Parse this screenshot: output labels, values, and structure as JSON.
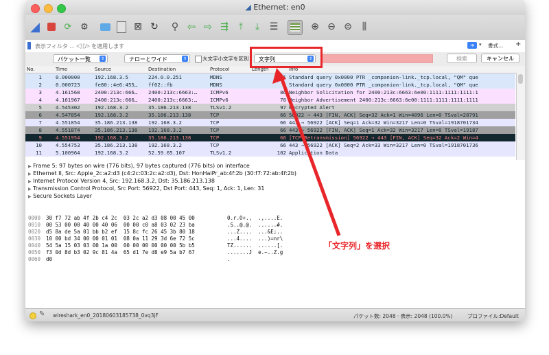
{
  "window": {
    "title": "Ethernet: en0"
  },
  "filter": {
    "placeholder": "表示フィルタ … <⌘/> を適用します",
    "format_label": "書式…",
    "add_label": "+"
  },
  "find": {
    "scope": "パケット一覧",
    "charset": "ナローとワイド",
    "case_label": "大文字小文字を区別",
    "type": "文字列",
    "search_label": "検索",
    "cancel_label": "キャンセル"
  },
  "columns": [
    "No.",
    "Time",
    "Source",
    "Destination",
    "Protocol",
    "Length",
    "Info"
  ],
  "packets": [
    {
      "no": "1",
      "time": "0.000000",
      "src": "192.168.3.5",
      "dst": "224.0.0.251",
      "proto": "MDNS",
      "len": "1",
      "info": "Standard query 0x0000 PTR _companion-link._tcp.local, \"QM\" que",
      "bg": "#dae7fb",
      "fg": "#12272e"
    },
    {
      "no": "2",
      "time": "0.000723",
      "src": "fe80::4e6:455…",
      "dst": "ff02::fb",
      "proto": "MDNS",
      "len": "1",
      "info": "Standard query 0x0000 PTR _companion-link._tcp.local, \"QM\" que",
      "bg": "#dae7fb",
      "fg": "#12272e"
    },
    {
      "no": "3",
      "time": "4.161568",
      "src": "2400:213c:666…",
      "dst": "2400:213c:6663:…",
      "proto": "ICMPv6",
      "len": "86",
      "info": "Neighbor Solicitation for 2400:213c:6663:6e00:1111:1111:1111:1",
      "bg": "#fce0ff",
      "fg": "#12272e"
    },
    {
      "no": "4",
      "time": "4.161967",
      "src": "2400:213c:666…",
      "dst": "2400:213c:6663:…",
      "proto": "ICMPv6",
      "len": "78",
      "info": "Neighbor Advertisement 2400:213c:6663:6e00:1111:1111:1111:1111",
      "bg": "#fce0ff",
      "fg": "#12272e"
    },
    {
      "no": "5",
      "time": "4.545302",
      "src": "192.168.3.2",
      "dst": "35.186.213.138",
      "proto": "TLSv1.2",
      "len": "97",
      "info": "Encrypted Alert",
      "bg": "#d0d0d0",
      "fg": "#12272e"
    },
    {
      "no": "6",
      "time": "4.547054",
      "src": "192.168.3.2",
      "dst": "35.186.213.138",
      "proto": "TCP",
      "len": "66",
      "info": "56922 → 443 [FIN, ACK] Seq=32 Ack=1 Win=4096 Len=0 TSval=28791",
      "bg": "#a0a0a0",
      "fg": "#12272e"
    },
    {
      "no": "7",
      "time": "4.551854",
      "src": "35.186.213.138",
      "dst": "192.168.3.2",
      "proto": "TCP",
      "len": "66",
      "info": "443 → 56922 [ACK] Seq=1 Ack=32 Win=3217 Len=0 TSval=1918701734",
      "bg": "#e7e6ff",
      "fg": "#12272e"
    },
    {
      "no": "8",
      "time": "4.551874",
      "src": "35.186.213.138",
      "dst": "192.168.3.2",
      "proto": "TCP",
      "len": "66",
      "info": "443 → 56922 [FIN, ACK] Seq=1 Ack=32 Win=3217 Len=0 TSval=19187",
      "bg": "#a0a0a0",
      "fg": "#12272e"
    },
    {
      "no": "9",
      "time": "4.551954",
      "src": "192.168.3.2",
      "dst": "35.186.213.138",
      "proto": "TCP",
      "len": "66",
      "info": "[TCP Retransmission] 56922 → 443 [FIN, ACK] Seq=32 Ack=2 Win=4",
      "bg": "#12272e",
      "fg": "#f78787"
    },
    {
      "no": "10",
      "time": "4.554753",
      "src": "35.186.213.138",
      "dst": "192.168.3.2",
      "proto": "TCP",
      "len": "66",
      "info": "443 → 56922 [ACK] Seq=2 Ack=33 Win=3217 Len=0 TSval=1918701736",
      "bg": "#e7e6ff",
      "fg": "#12272e"
    },
    {
      "no": "11",
      "time": "5.100964",
      "src": "192.168.3.2",
      "dst": "52.59.65.107",
      "proto": "TLSv1.2",
      "len": "102",
      "info": "Application Data",
      "bg": "#e7e6ff",
      "fg": "#12272e"
    }
  ],
  "details": [
    "Frame 5: 97 bytes on wire (776 bits), 97 bytes captured (776 bits) on interface",
    "Ethernet II, Src: Apple_2c:a2:d3 (c4:2c:03:2c:a2:d3), Dst: HonHaiPr_ab:4f:2b (30:f7:72:ab:4f:2b)",
    "Internet Protocol Version 4, Src: 192.168.3.2, Dst: 35.186.213.138",
    "Transmission Control Protocol, Src Port: 56922, Dst Port: 443, Seq: 1, Ack: 1, Len: 31",
    "Secure Sockets Layer"
  ],
  "hex": [
    {
      "off": "0000",
      "bytes": "30 f7 72 ab 4f 2b c4 2c  03 2c a2 d3 08 00 45 00",
      "ascii": "0.r.O+.,  .,....E."
    },
    {
      "off": "0010",
      "bytes": "00 53 00 00 40 00 40 06  00 00 c0 a8 03 02 23 ba",
      "ascii": ".S..@.@.  ......#."
    },
    {
      "off": "0020",
      "bytes": "d5 8a de 5a 01 bb b2 ef  15 8c fc 26 45 3b 80 18",
      "ascii": "...Z....  ...&E;.."
    },
    {
      "off": "0030",
      "bytes": "10 00 bd 34 00 00 01 01  08 0a 11 29 3d 6e 72 5c",
      "ascii": "...4....  ...)=nr\\"
    },
    {
      "off": "0040",
      "bytes": "54 5a 15 03 03 00 1a 00  00 00 00 00 00 00 5b b5",
      "ascii": "TZ......  ......[."
    },
    {
      "off": "0050",
      "bytes": "f3 0d 8d b3 02 9c 81 4a  65 d1 7e d8 e9 5a b7 67",
      "ascii": ".......J  e.~..Z.g"
    },
    {
      "off": "0060",
      "bytes": "d0",
      "ascii": "."
    }
  ],
  "status": {
    "file": "wireshark_en0_20180603185738_0vq3jF",
    "packets": "パケット数: 2048 · 表示: 2048 (100.0%)",
    "profile": "プロファイル:Default"
  },
  "annotation": "「文字列」を選択",
  "colors": {
    "accent": "#e8262a",
    "selected_row": "#12272e"
  }
}
